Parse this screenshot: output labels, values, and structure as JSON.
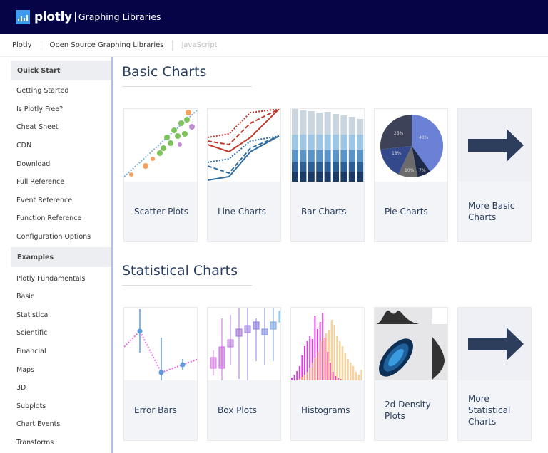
{
  "header": {
    "brand": "plotly",
    "subtitle": "Graphing Libraries"
  },
  "breadcrumb": [
    "Plotly",
    "Open Source Graphing Libraries",
    "JavaScript"
  ],
  "sidebar": {
    "sections": [
      {
        "title": "Quick Start",
        "items": [
          "Getting Started",
          "Is Plotly Free?",
          "Cheat Sheet",
          "CDN",
          "Download",
          "Full Reference",
          "Event Reference",
          "Function Reference",
          "Configuration Options"
        ]
      },
      {
        "title": "Examples",
        "items": [
          "Plotly Fundamentals",
          "Basic",
          "Statistical",
          "Scientific",
          "Financial",
          "Maps",
          "3D",
          "Subplots",
          "Chart Events",
          "Transforms"
        ]
      }
    ]
  },
  "basic": {
    "title": "Basic Charts",
    "cards": [
      "Scatter Plots",
      "Line Charts",
      "Bar Charts",
      "Pie Charts",
      "More Basic Charts"
    ]
  },
  "statistical": {
    "title": "Statistical Charts",
    "cards": [
      "Error Bars",
      "Box Plots",
      "Histograms",
      "2d Density Plots",
      "More Statistical Charts"
    ]
  },
  "pie_thumb_labels": [
    "40%",
    "25%",
    "18%",
    "10%",
    "7%"
  ],
  "colors": {
    "header": "#040447",
    "accent": "#3d9cf0",
    "text": "#2a3f5f"
  }
}
